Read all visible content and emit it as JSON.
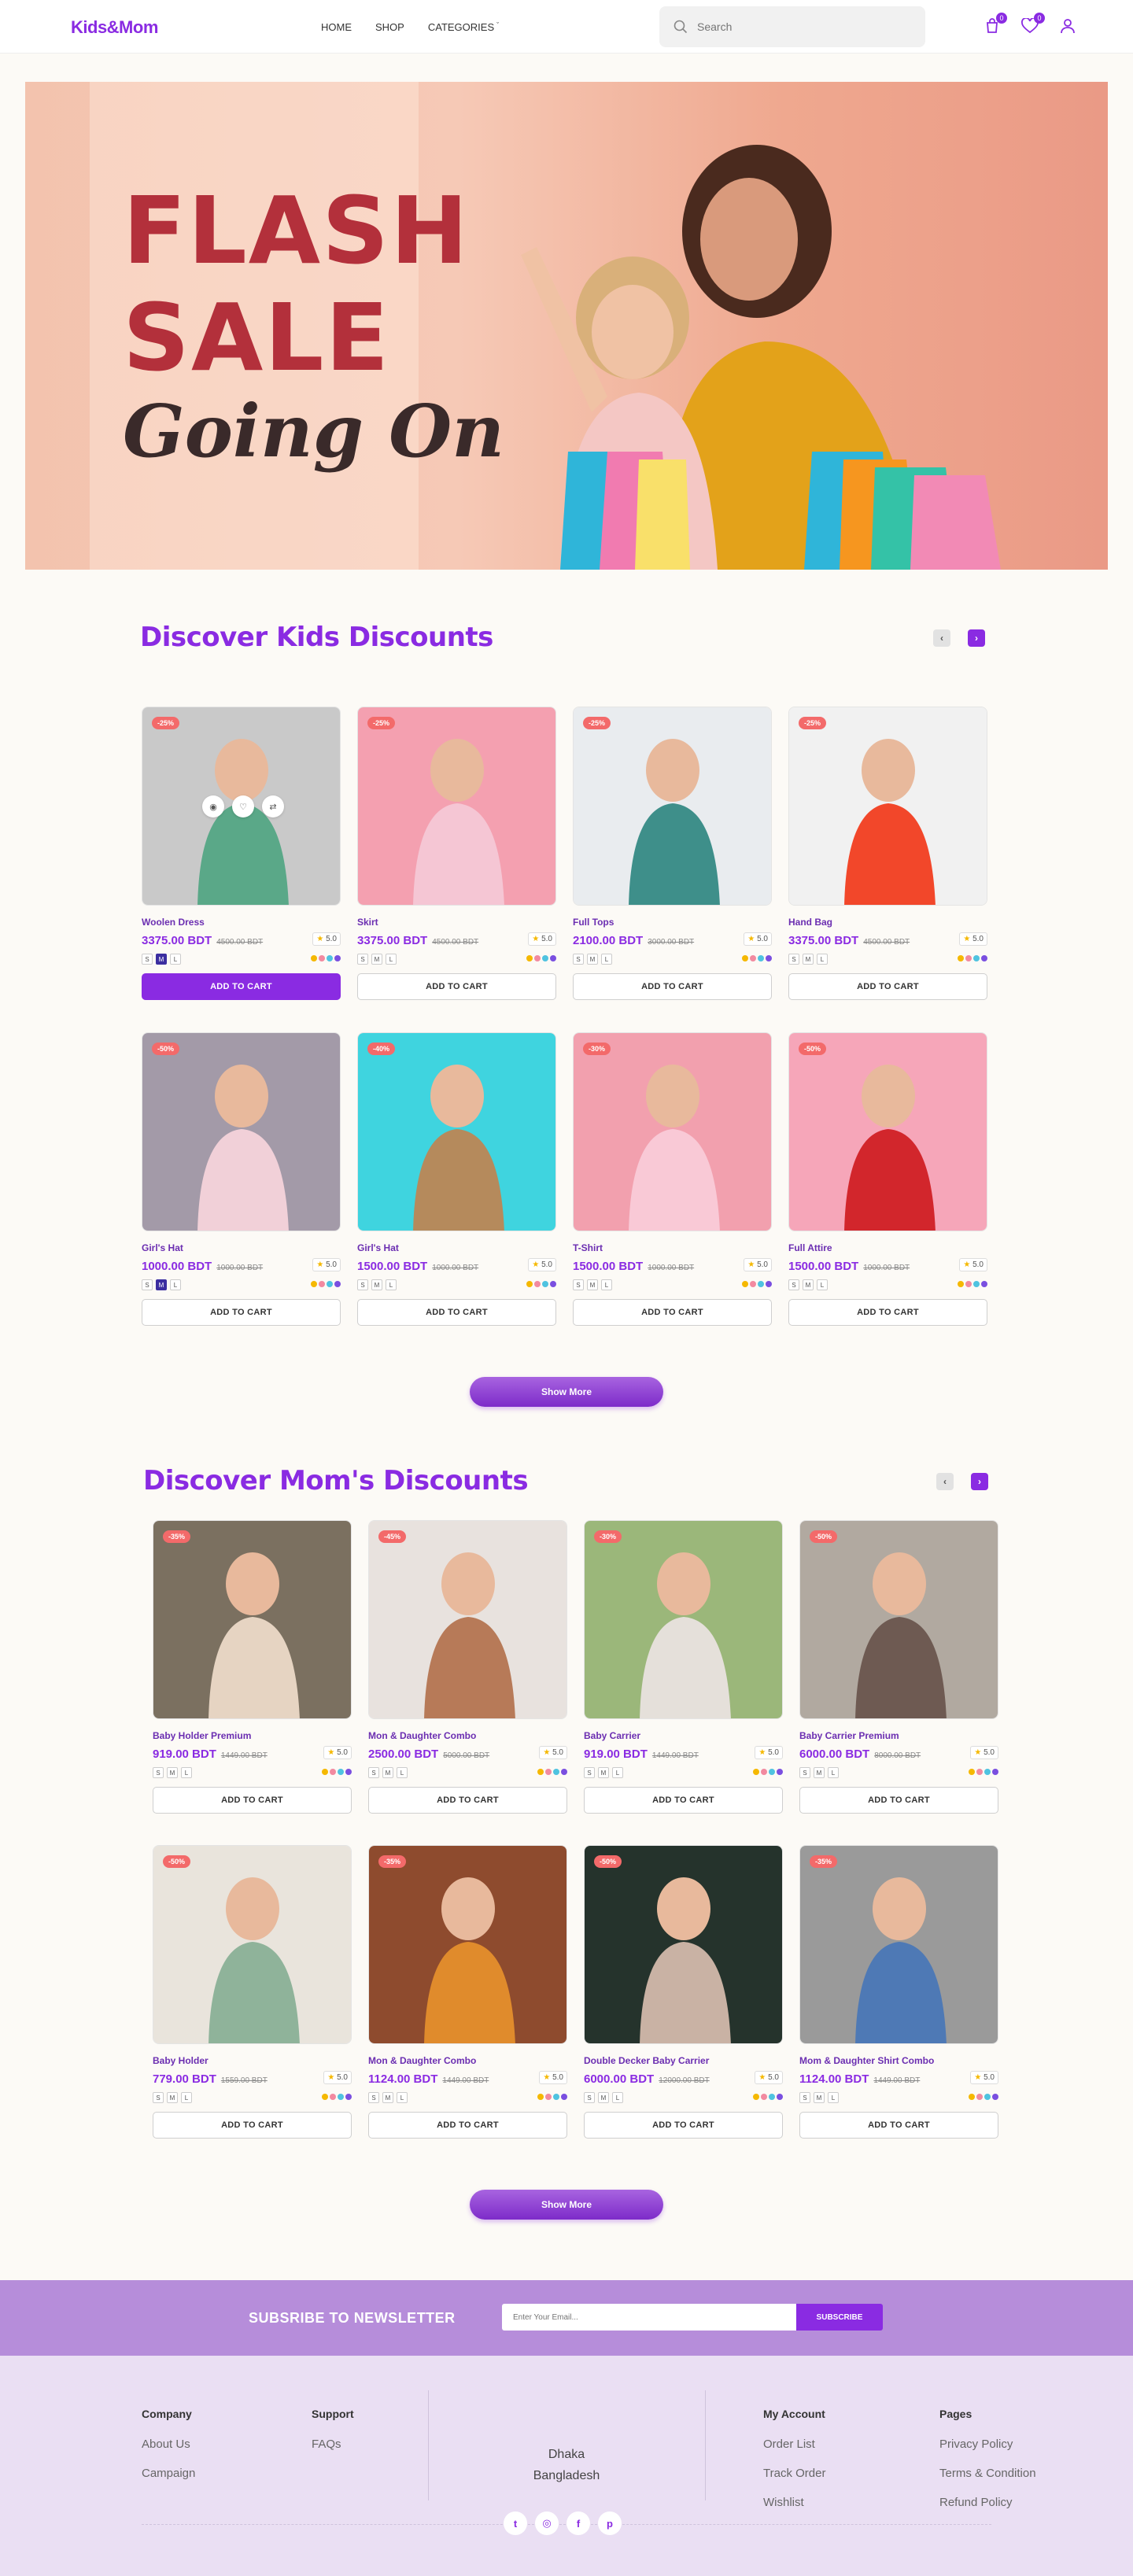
{
  "header": {
    "logo": "Kids&Mom",
    "nav": [
      "HOME",
      "SHOP",
      "CATEGORIES"
    ],
    "search_placeholder": "Search",
    "cart_count": "0",
    "wishlist_count": "0"
  },
  "hero": {
    "line1": "FLASH",
    "line2": "SALE",
    "line3": "Going On"
  },
  "kids": {
    "title": "Discover Kids Discounts",
    "products": [
      {
        "badge": "-25%",
        "name": "Woolen Dress",
        "price": "3375.00 BDT",
        "old": "4500.00 BDT",
        "rating": "5.0",
        "cart": "ADD TO CART"
      },
      {
        "badge": "-25%",
        "name": "Skirt",
        "price": "3375.00 BDT",
        "old": "4500.00 BDT",
        "rating": "5.0",
        "cart": "ADD TO CART"
      },
      {
        "badge": "-25%",
        "name": "Full Tops",
        "price": "2100.00 BDT",
        "old": "3000.00 BDT",
        "rating": "5.0",
        "cart": "ADD TO CART"
      },
      {
        "badge": "-25%",
        "name": "Hand Bag",
        "price": "3375.00 BDT",
        "old": "4500.00 BDT",
        "rating": "5.0",
        "cart": "ADD TO CART"
      },
      {
        "badge": "-50%",
        "name": "Girl's Hat",
        "price": "1000.00 BDT",
        "old": "1000.00 BDT",
        "rating": "5.0",
        "cart": "ADD TO CART"
      },
      {
        "badge": "-40%",
        "name": "Girl's Hat",
        "price": "1500.00 BDT",
        "old": "1000.00 BDT",
        "rating": "5.0",
        "cart": "ADD TO CART"
      },
      {
        "badge": "-30%",
        "name": "T-Shirt",
        "price": "1500.00 BDT",
        "old": "1000.00 BDT",
        "rating": "5.0",
        "cart": "ADD TO CART"
      },
      {
        "badge": "-50%",
        "name": "Full Attire",
        "price": "1500.00 BDT",
        "old": "1000.00 BDT",
        "rating": "5.0",
        "cart": "ADD TO CART"
      }
    ],
    "show_more": "Show More"
  },
  "moms": {
    "title": "Discover Mom's Discounts",
    "products": [
      {
        "badge": "-35%",
        "name": "Baby Holder Premium",
        "price": "919.00 BDT",
        "old": "1449.00 BDT",
        "rating": "5.0",
        "cart": "ADD TO CART"
      },
      {
        "badge": "-45%",
        "name": "Mon & Daughter Combo",
        "price": "2500.00 BDT",
        "old": "5000.00 BDT",
        "rating": "5.0",
        "cart": "ADD TO CART"
      },
      {
        "badge": "-30%",
        "name": "Baby Carrier",
        "price": "919.00 BDT",
        "old": "1449.00 BDT",
        "rating": "5.0",
        "cart": "ADD TO CART"
      },
      {
        "badge": "-50%",
        "name": "Baby Carrier Premium",
        "price": "6000.00 BDT",
        "old": "8000.00 BDT",
        "rating": "5.0",
        "cart": "ADD TO CART"
      },
      {
        "badge": "-50%",
        "name": "Baby Holder",
        "price": "779.00 BDT",
        "old": "1559.00 BDT",
        "rating": "5.0",
        "cart": "ADD TO CART"
      },
      {
        "badge": "-35%",
        "name": "Mon & Daughter Combo",
        "price": "1124.00 BDT",
        "old": "1449.00 BDT",
        "rating": "5.0",
        "cart": "ADD TO CART"
      },
      {
        "badge": "-50%",
        "name": "Double Decker Baby Carrier",
        "price": "6000.00 BDT",
        "old": "12000.00 BDT",
        "rating": "5.0",
        "cart": "ADD TO CART"
      },
      {
        "badge": "-35%",
        "name": "Mom & Daughter Shirt Combo",
        "price": "1124.00 BDT",
        "old": "1449.00 BDT",
        "rating": "5.0",
        "cart": "ADD TO CART"
      }
    ],
    "show_more": "Show More"
  },
  "sizes": [
    "S",
    "M",
    "L"
  ],
  "swatch_colors": [
    "#f5b800",
    "#f28aa0",
    "#4fc3e0",
    "#7a4fe0"
  ],
  "newsletter": {
    "title": "SUBSRIBE TO NEWSLETTER",
    "placeholder": "Enter Your Email...",
    "button": "SUBSCRIBE"
  },
  "footer": {
    "company": {
      "title": "Company",
      "links": [
        "About Us",
        "Campaign"
      ]
    },
    "support": {
      "title": "Support",
      "links": [
        "FAQs"
      ]
    },
    "address": {
      "line1": "Dhaka",
      "line2": "Bangladesh"
    },
    "account": {
      "title": "My Account",
      "links": [
        "Order List",
        "Track Order",
        "Wishlist"
      ]
    },
    "pages": {
      "title": "Pages",
      "links": [
        "Privacy Policy",
        "Terms & Condition",
        "Refund Policy"
      ]
    },
    "socials": [
      "twitter-icon",
      "instagram-icon",
      "facebook-icon",
      "pinterest-icon"
    ]
  },
  "colors": {
    "accent": "#8a2be2",
    "badge": "#f36a6a",
    "newsletter_bg": "#b68dda",
    "footer_bg": "#eadff3"
  }
}
